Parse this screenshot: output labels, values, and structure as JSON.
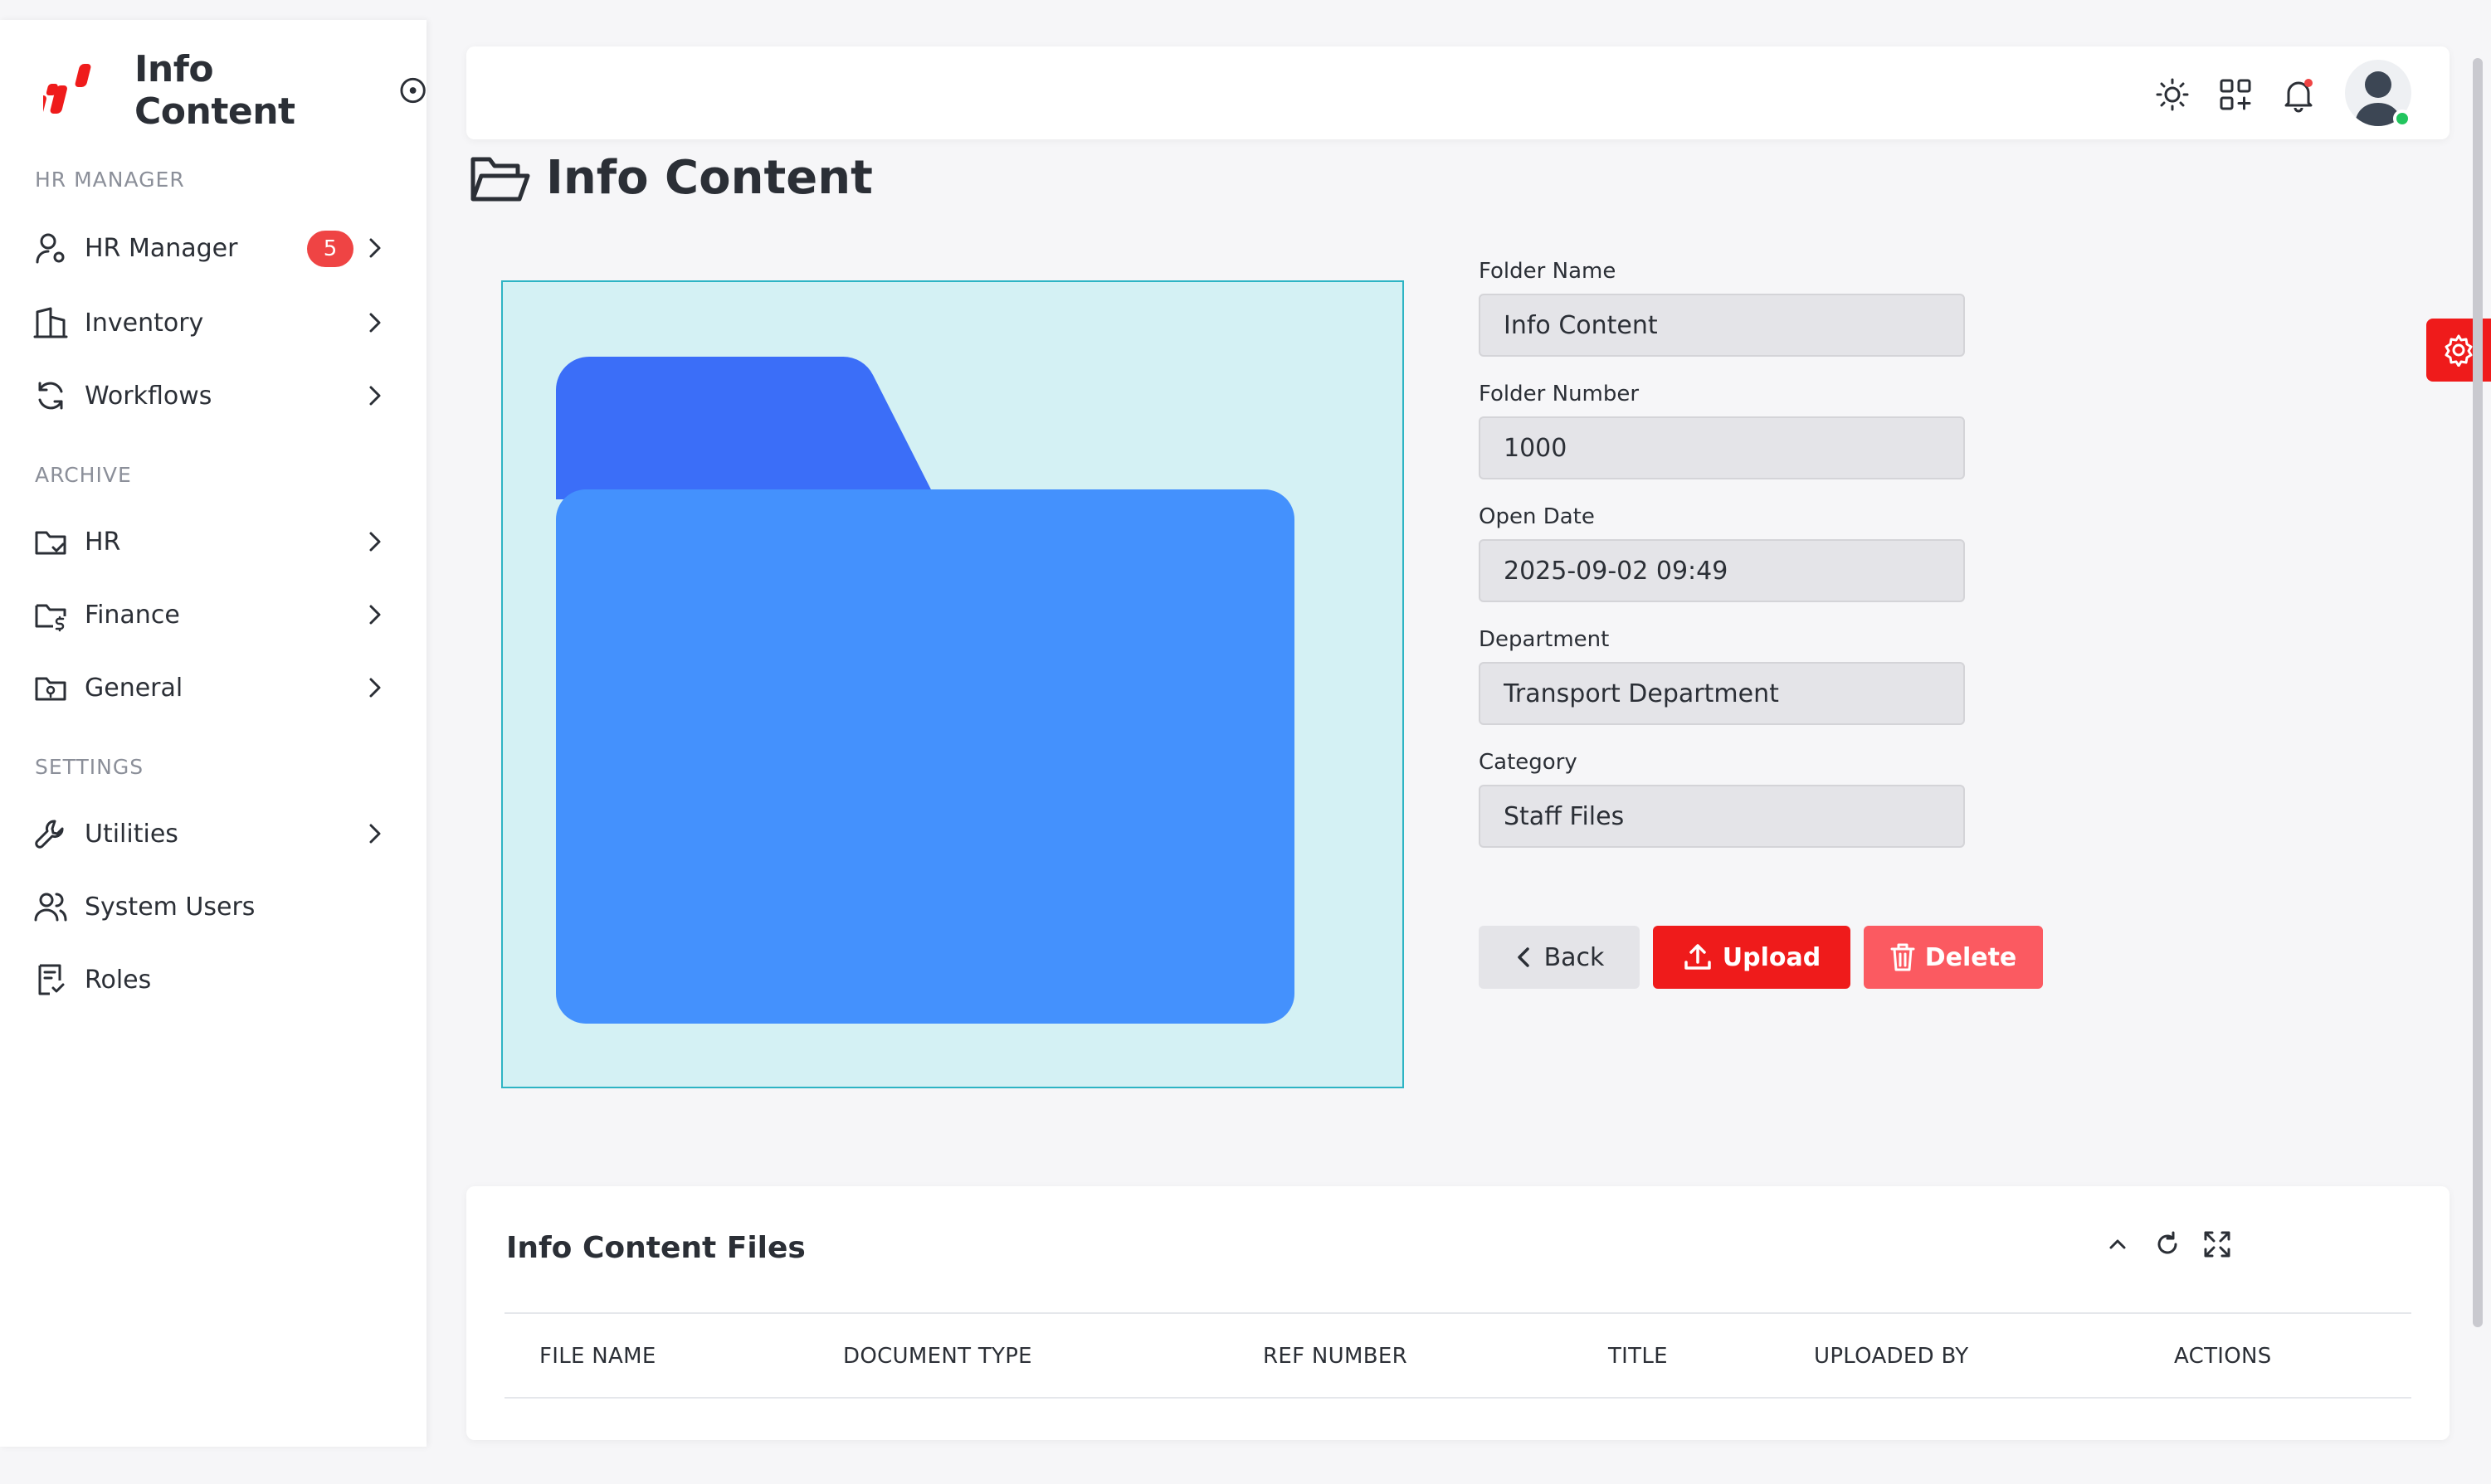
{
  "sidebar": {
    "brand": "Info Content",
    "sections": {
      "hr_manager": "HR MANAGER",
      "archive": "ARCHIVE",
      "settings": "SETTINGS"
    },
    "items": {
      "hr_manager": "HR Manager",
      "hr_manager_badge": "5",
      "inventory": "Inventory",
      "workflows": "Workflows",
      "hr": "HR",
      "finance": "Finance",
      "general": "General",
      "utilities": "Utilities",
      "system_users": "System Users",
      "roles": "Roles"
    }
  },
  "page": {
    "title": "Info Content"
  },
  "form": {
    "folder_name_label": "Folder Name",
    "folder_name_value": "Info Content",
    "folder_number_label": "Folder Number",
    "folder_number_value": "1000",
    "open_date_label": "Open Date",
    "open_date_value": "2025-09-02 09:49",
    "department_label": "Department",
    "department_value": "Transport Department",
    "category_label": "Category",
    "category_value": "Staff Files"
  },
  "buttons": {
    "back": "Back",
    "upload": "Upload",
    "delete": "Delete"
  },
  "files_card": {
    "title": "Info Content Files",
    "columns": [
      "FILE NAME",
      "DOCUMENT TYPE",
      "REF NUMBER",
      "TITLE",
      "UPLOADED BY",
      "ACTIONS"
    ]
  },
  "colors": {
    "accent_red": "#ef1b1b",
    "delete_red": "#fb5a61",
    "folder_back": "#3b6ef8",
    "folder_front": "#4491fd",
    "preview_bg": "#d4f1f4",
    "online_status": "#22c55e"
  }
}
